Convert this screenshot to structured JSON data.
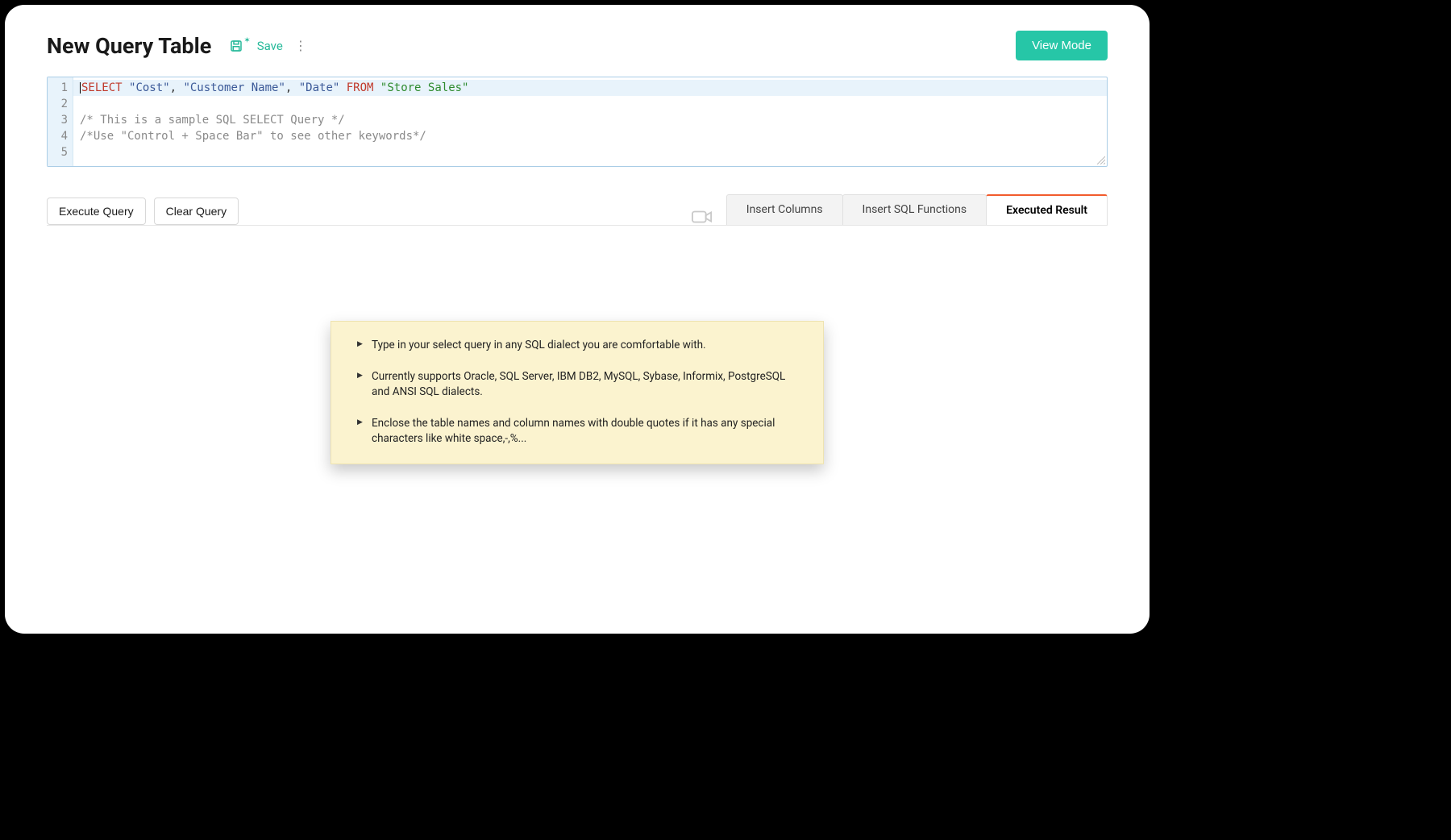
{
  "header": {
    "title": "New Query Table",
    "save_label": "Save",
    "view_mode_label": "View Mode"
  },
  "editor": {
    "line_numbers": [
      "1",
      "2",
      "3",
      "4",
      "5"
    ],
    "line1": {
      "select_kw": "SELECT",
      "col1": "\"Cost\"",
      "sep1": ", ",
      "col2": "\"Customer Name\"",
      "sep2": ", ",
      "col3": "\"Date\"",
      "from_kw": " FROM ",
      "table": "\"Store Sales\""
    },
    "line3": "/* This is a sample SQL SELECT Query */",
    "line4": "/*Use \"Control + Space Bar\" to see other keywords*/"
  },
  "actions": {
    "execute": "Execute Query",
    "clear": "Clear Query"
  },
  "tabs": {
    "insert_columns": "Insert Columns",
    "insert_functions": "Insert SQL Functions",
    "executed_result": "Executed Result"
  },
  "tips": {
    "t1": "Type in your select query in any SQL dialect you are comfortable with.",
    "t2": "Currently supports Oracle, SQL Server, IBM DB2, MySQL, Sybase, Informix, PostgreSQL and ANSI SQL dialects.",
    "t3": "Enclose the table names and column names with double quotes if it has any special characters like white space,-,%..."
  }
}
